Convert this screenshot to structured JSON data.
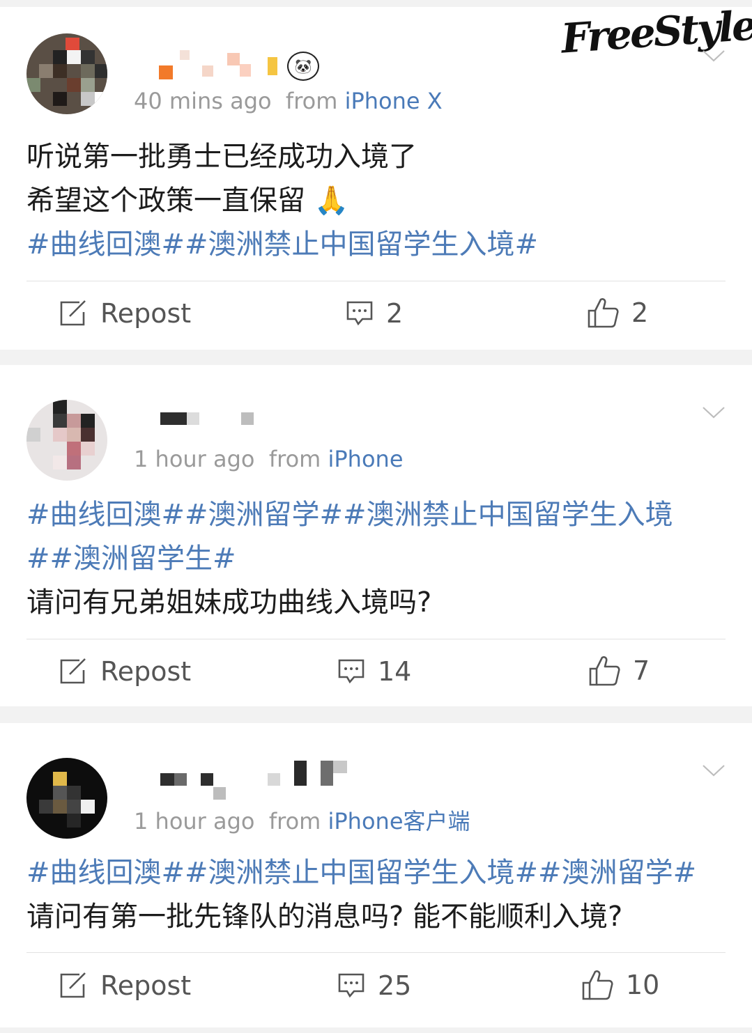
{
  "watermark": "FreeStyle",
  "posts": [
    {
      "time": "40 mins ago",
      "from_prefix": "from ",
      "source": "iPhone X",
      "lines": [
        {
          "text": "听说第一批勇士已经成功入境了",
          "tag": false
        },
        {
          "text": "希望这个政策一直保留",
          "tag": false,
          "emoji": "🙏"
        },
        {
          "text": "#曲线回澳##澳洲禁止中国留学生入境#",
          "tag": true
        }
      ],
      "repost_label": "Repost",
      "comments": "2",
      "likes": "2"
    },
    {
      "time": "1 hour ago",
      "from_prefix": "from ",
      "source": "iPhone",
      "lines": [
        {
          "text": "#曲线回澳##澳洲留学##澳洲禁止中国留学生入境",
          "tag": true
        },
        {
          "text": "##澳洲留学生#",
          "tag": true
        },
        {
          "text": "请问有兄弟姐妹成功曲线入境吗?",
          "tag": false
        }
      ],
      "repost_label": "Repost",
      "comments": "14",
      "likes": "7"
    },
    {
      "time": "1 hour ago",
      "from_prefix": "from ",
      "source": "iPhone客户端",
      "lines": [
        {
          "text": "#曲线回澳##澳洲禁止中国留学生入境##澳洲留学#",
          "tag": true
        },
        {
          "text": "请问有第一批先锋队的消息吗?  能不能顺利入境?",
          "tag": false
        }
      ],
      "repost_label": "Repost",
      "comments": "25",
      "likes": "10"
    }
  ],
  "colors": {
    "tag": "#4d7bb7",
    "meta": "#9a9a9a",
    "text": "#1c1c1c",
    "icon": "#555555"
  },
  "icons": {
    "repost": "repost-icon",
    "comment": "comment-icon",
    "like": "thumbs-up-icon",
    "menu": "chevron-down-icon"
  }
}
